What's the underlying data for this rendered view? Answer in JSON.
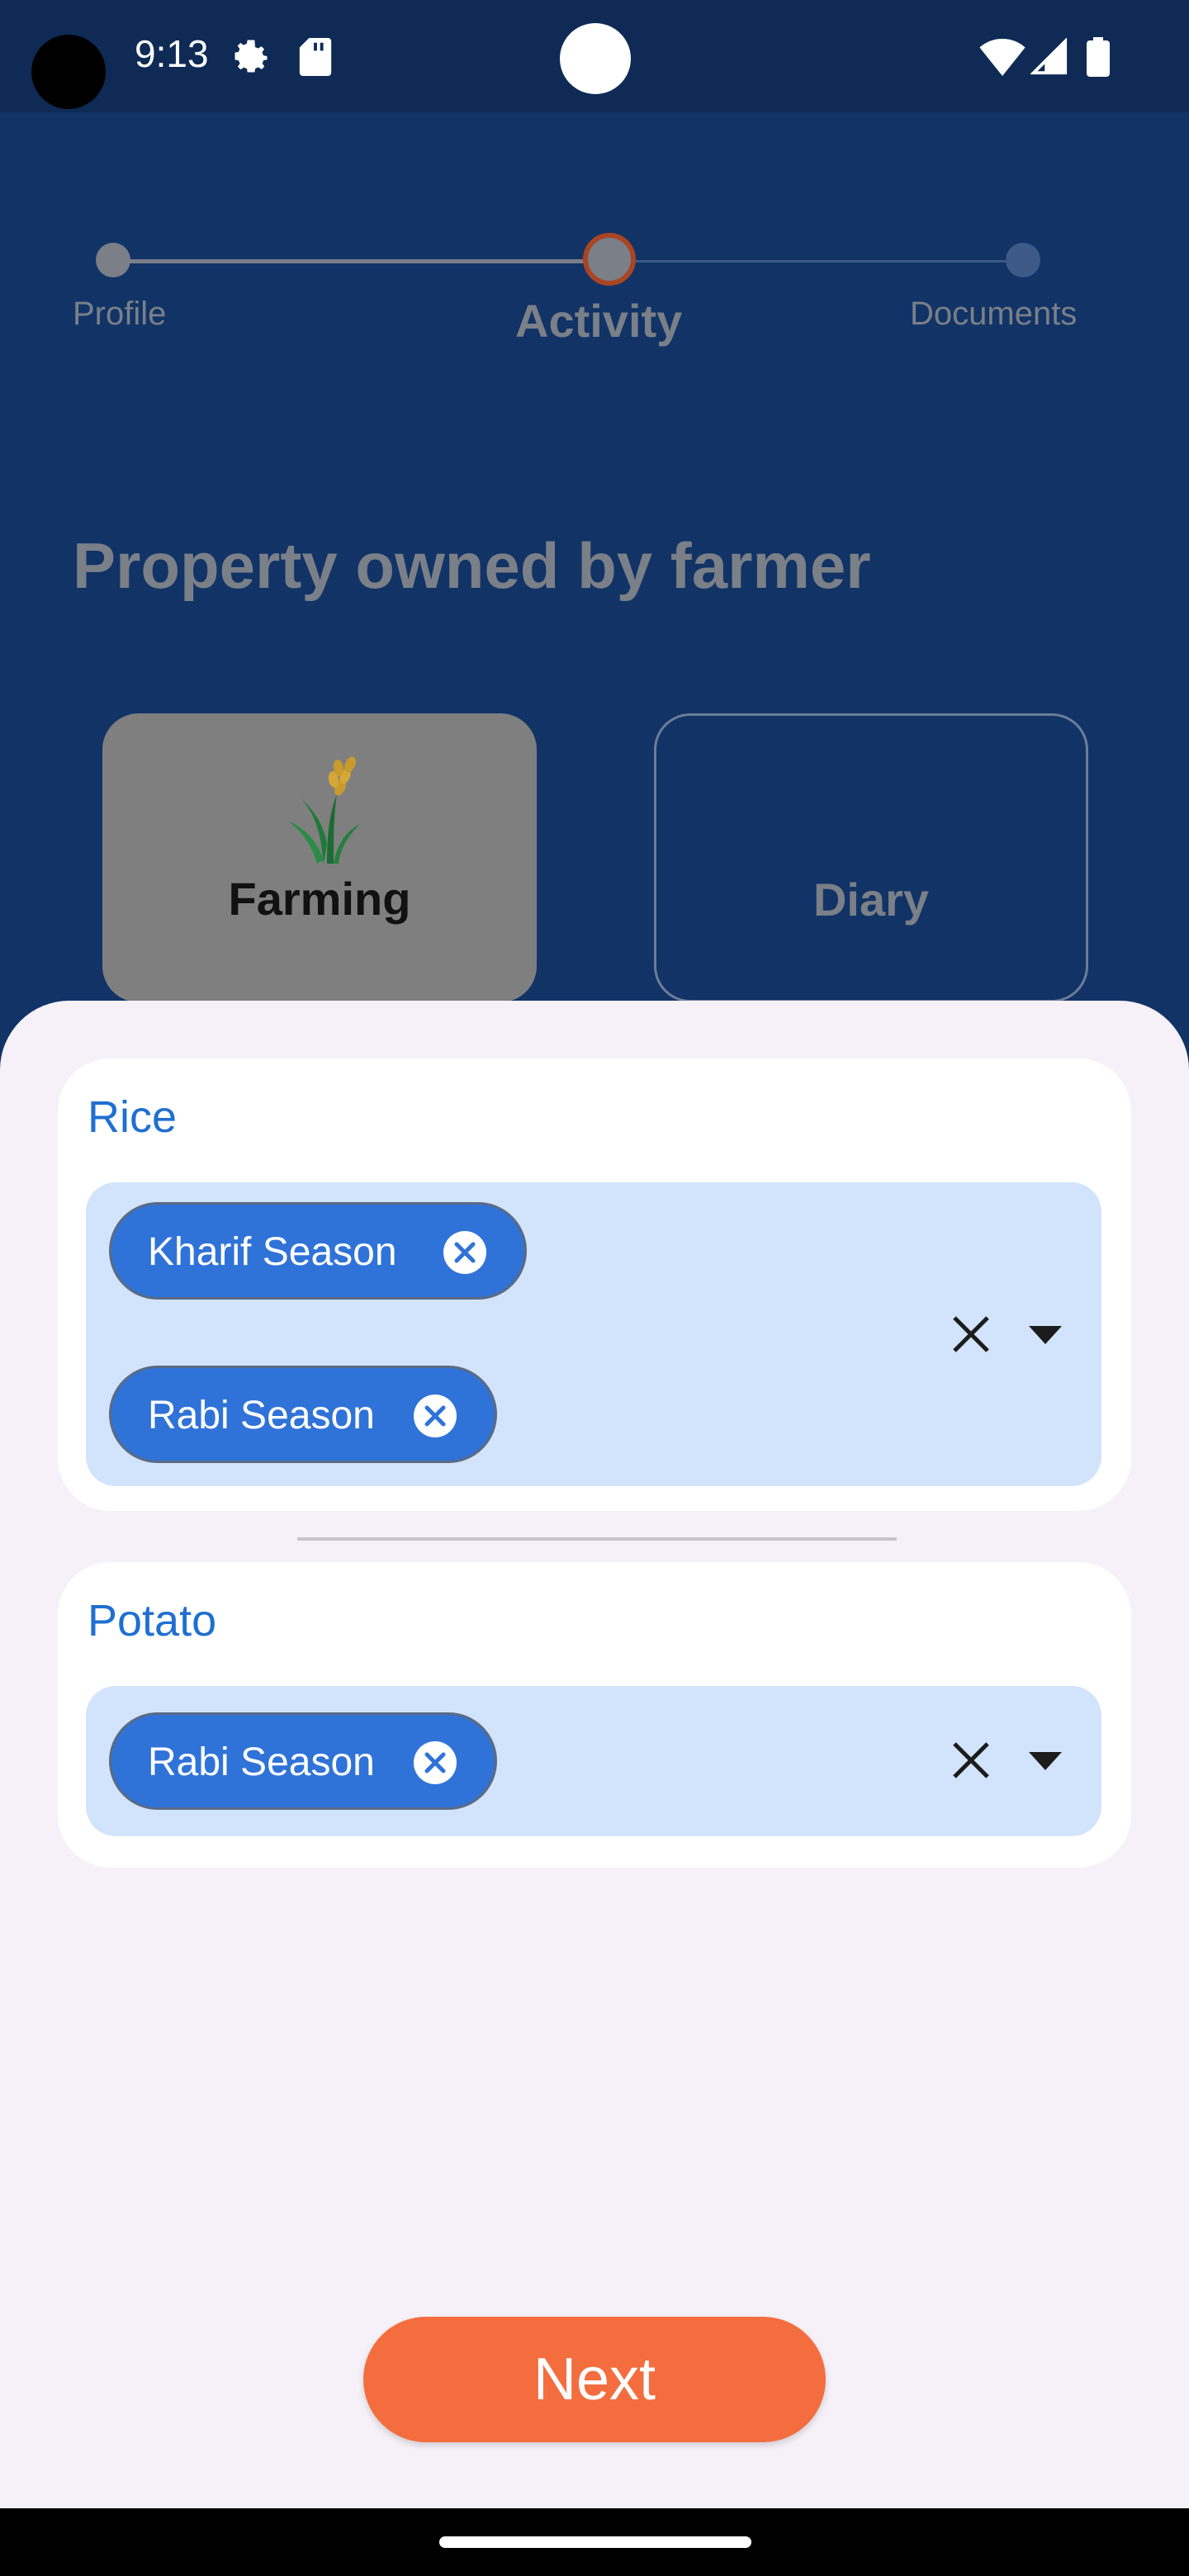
{
  "status_bar": {
    "time": "9:13",
    "icons": [
      "gear-icon",
      "sd-card-icon",
      "wifi-icon",
      "signal-icon",
      "battery-icon"
    ]
  },
  "stepper": {
    "steps": [
      {
        "label": "Profile",
        "state": "done"
      },
      {
        "label": "Activity",
        "state": "current"
      },
      {
        "label": "Documents",
        "state": "todo"
      }
    ]
  },
  "heading": "Property owned by farmer",
  "activity_tiles": [
    {
      "label": "Farming",
      "selected": true,
      "icon": "wheat-icon"
    },
    {
      "label": "Diary",
      "selected": false
    }
  ],
  "crops": [
    {
      "name": "Rice",
      "seasons": [
        "Kharif Season",
        "Rabi Season"
      ]
    },
    {
      "name": "Potato",
      "seasons": [
        "Rabi Season"
      ]
    }
  ],
  "next_label": "Next",
  "colors": {
    "background": "#113366",
    "sheet": "#f6f1f8",
    "chip": "#2f73d8",
    "select_bg": "#d1e4fb",
    "accent_title": "#1f6fd1",
    "next_button": "#f46d3f",
    "stepper_current_ring": "#a94523"
  }
}
